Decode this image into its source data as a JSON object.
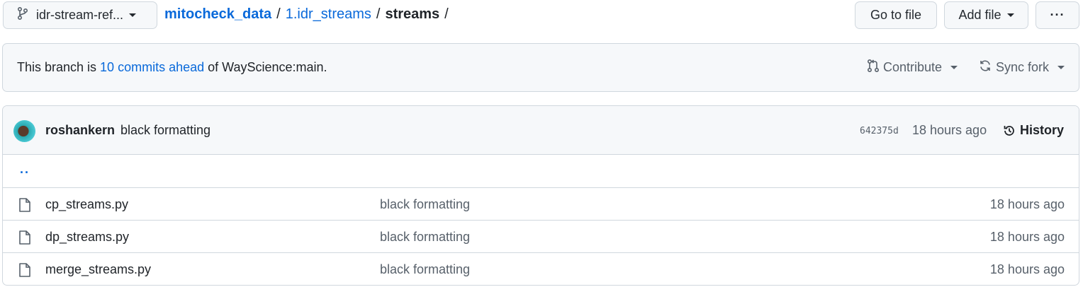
{
  "branch": {
    "label": "idr-stream-ref..."
  },
  "breadcrumb": {
    "repo": "mitocheck_data",
    "sep": "/",
    "dir": "1.idr_streams",
    "current": "streams"
  },
  "toolbar": {
    "goto_label": "Go to file",
    "addfile_label": "Add file",
    "more_label": "···"
  },
  "banner": {
    "prefix": "This branch is ",
    "link": "10 commits ahead",
    "suffix": " of WayScience:main.",
    "contribute_label": "Contribute",
    "sync_label": "Sync fork"
  },
  "latest_commit": {
    "author": "roshankern",
    "message": "black formatting",
    "sha": "642375d",
    "time": "18 hours ago",
    "history_label": "History"
  },
  "parent_link": "..",
  "files": [
    {
      "name": "cp_streams.py",
      "commit": "black formatting",
      "time": "18 hours ago"
    },
    {
      "name": "dp_streams.py",
      "commit": "black formatting",
      "time": "18 hours ago"
    },
    {
      "name": "merge_streams.py",
      "commit": "black formatting",
      "time": "18 hours ago"
    }
  ],
  "colors": {
    "accent": "#0969da",
    "muted": "#57606a",
    "border": "#d0d7de",
    "subtle_bg": "#f6f8fa"
  }
}
